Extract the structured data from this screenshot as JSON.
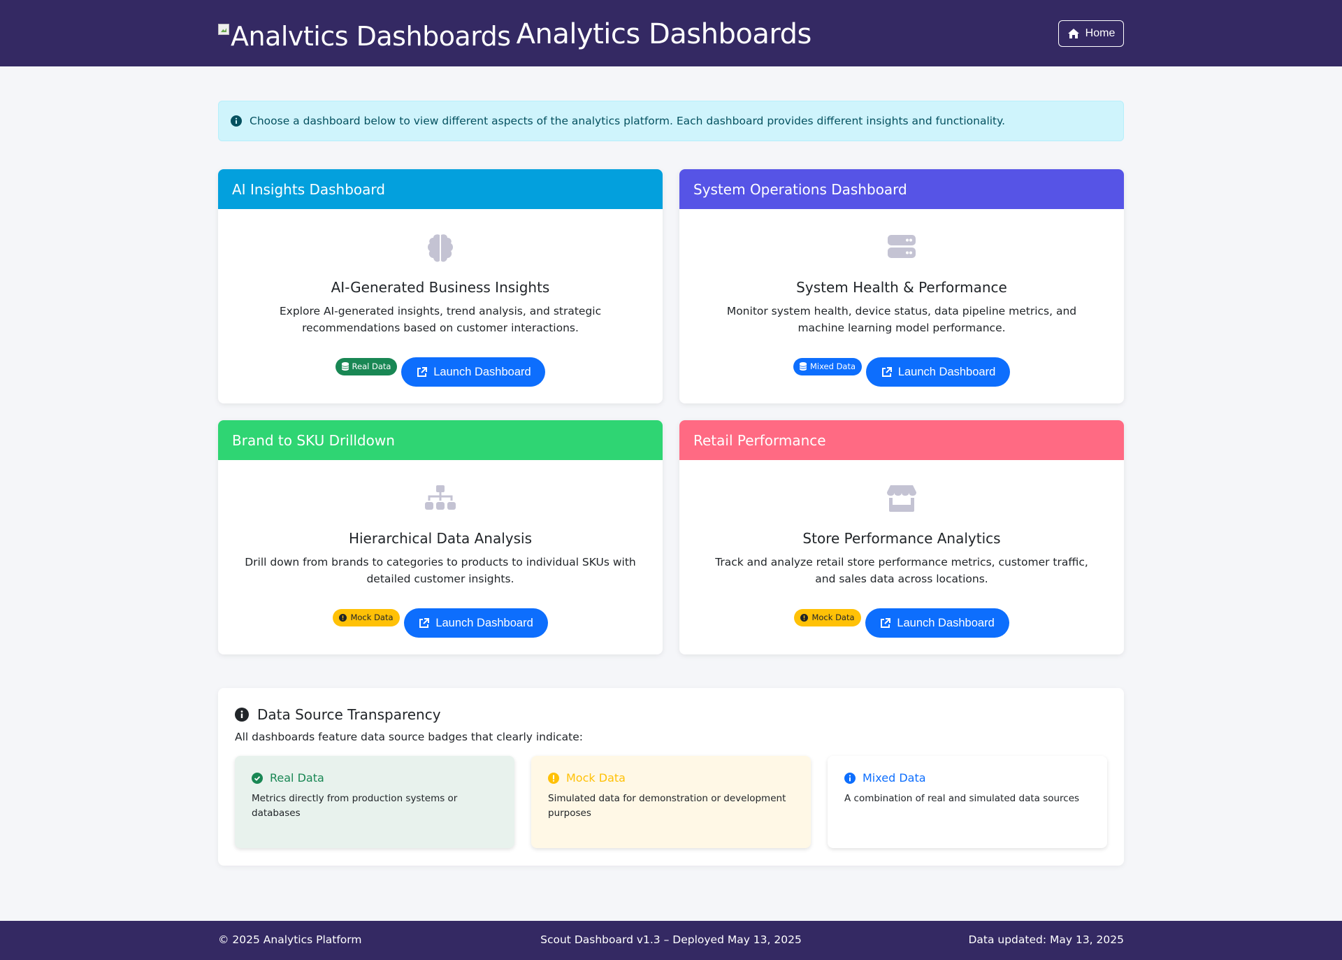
{
  "header": {
    "logo_alt": "Analvtics Dashboards",
    "title": "Analytics Dashboards",
    "home_label": "Home"
  },
  "alert": {
    "text": "Choose a dashboard below to view different aspects of the analytics platform. Each dashboard provides different insights and functionality."
  },
  "cards": [
    {
      "header": "AI Insights Dashboard",
      "header_color": "#03a0dd",
      "icon": "brain-icon",
      "subtitle": "AI-Generated Business Insights",
      "description": "Explore AI-generated insights, trend analysis, and strategic recommendations based on customer interactions.",
      "badge": "Real Data",
      "button": "Launch Dashboard"
    },
    {
      "header": "System Operations Dashboard",
      "header_color": "#5654e6",
      "icon": "server-icon",
      "subtitle": "System Health & Performance",
      "description": "Monitor system health, device status, data pipeline metrics, and machine learning model performance.",
      "badge": "Mixed Data",
      "button": "Launch Dashboard"
    },
    {
      "header": "Brand to SKU Drilldown",
      "header_color": "#2fd573",
      "icon": "sitemap-icon",
      "subtitle": "Hierarchical Data Analysis",
      "description": "Drill down from brands to categories to products to individual SKUs with detailed customer insights.",
      "badge": "Mock Data",
      "button": "Launch Dashboard"
    },
    {
      "header": "Retail Performance",
      "header_color": "#ff6a83",
      "icon": "store-icon",
      "subtitle": "Store Performance Analytics",
      "description": "Track and analyze retail store performance metrics, customer traffic, and sales data across locations.",
      "badge": "Mock Data",
      "button": "Launch Dashboard"
    }
  ],
  "transparency": {
    "title": "Data Source Transparency",
    "intro": "All dashboards feature data source badges that clearly indicate:",
    "sources": [
      {
        "label": "Real Data",
        "description": "Metrics directly from production systems or databases",
        "color": "#198754",
        "bg": "#e8f2ed"
      },
      {
        "label": "Mock Data",
        "description": "Simulated data for demonstration or development purposes",
        "color": "#ffc107",
        "bg": "#fff8e6"
      },
      {
        "label": "Mixed Data",
        "description": "A combination of real and simulated data sources",
        "color": "#0d6efd",
        "bg": "#ffffff"
      }
    ]
  },
  "footer": {
    "copyright": "© 2025 Analytics Platform",
    "version": "Scout Dashboard v1.3 – Deployed May 13, 2025",
    "updated": "Data updated: May 13, 2025"
  }
}
